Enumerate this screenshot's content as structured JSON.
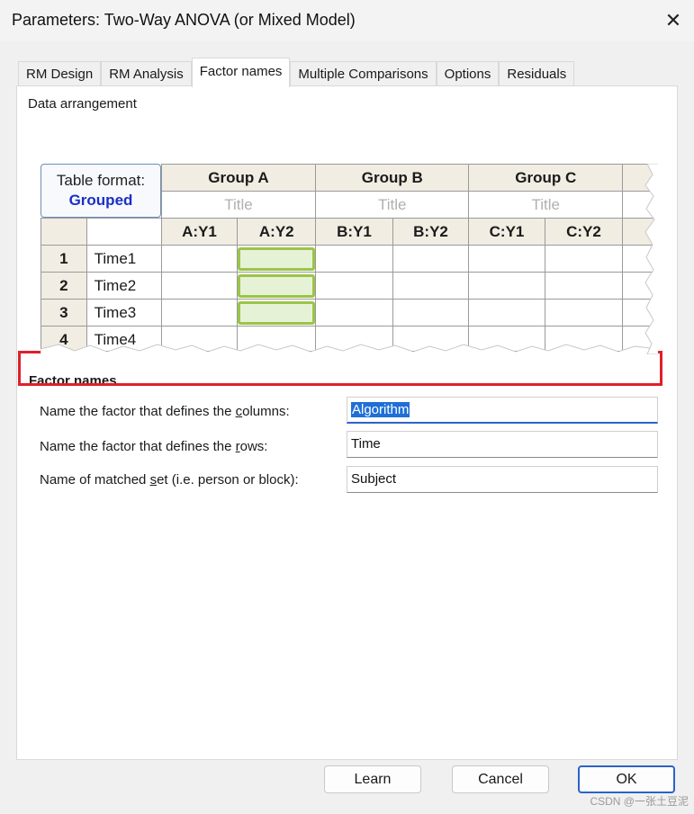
{
  "window": {
    "title": "Parameters: Two-Way ANOVA (or Mixed Model)",
    "close_glyph": "✕"
  },
  "tabs": [
    {
      "label": "RM Design"
    },
    {
      "label": "RM Analysis"
    },
    {
      "label": "Factor names"
    },
    {
      "label": "Multiple Comparisons"
    },
    {
      "label": "Options"
    },
    {
      "label": "Residuals"
    }
  ],
  "data_arrangement": {
    "label": "Data arrangement",
    "table_format_label": "Table format:",
    "table_format_value": "Grouped",
    "groups": [
      "Group A",
      "Group B",
      "Group C"
    ],
    "group_title_placeholder": "Title",
    "columns": [
      "A:Y1",
      "A:Y2",
      "B:Y1",
      "B:Y2",
      "C:Y1",
      "C:Y2"
    ],
    "rows": [
      {
        "num": "1",
        "label": "Time1"
      },
      {
        "num": "2",
        "label": "Time2"
      },
      {
        "num": "3",
        "label": "Time3"
      },
      {
        "num": "4",
        "label": "Time4"
      }
    ]
  },
  "factor_names": {
    "heading": "Factor names",
    "columns_label_pre": "Name the factor that defines the ",
    "columns_label_u": "c",
    "columns_label_post": "olumns:",
    "columns_value": "Algorithm",
    "rows_label_pre": "Name the factor that defines the ",
    "rows_label_u": "r",
    "rows_label_post": "ows:",
    "rows_value": "Time",
    "matched_label_pre": "Name of matched ",
    "matched_label_u": "s",
    "matched_label_post": "et (i.e. person or block):",
    "matched_value": "Subject"
  },
  "buttons": {
    "learn": "Learn",
    "cancel": "Cancel",
    "ok": "OK"
  },
  "watermark": "CSDN @一张土豆泥",
  "colors": {
    "highlight": "#e0202a",
    "accent": "#2a63c9",
    "grouped_text": "#1a2fc7",
    "green_cell": "#9bc548"
  }
}
